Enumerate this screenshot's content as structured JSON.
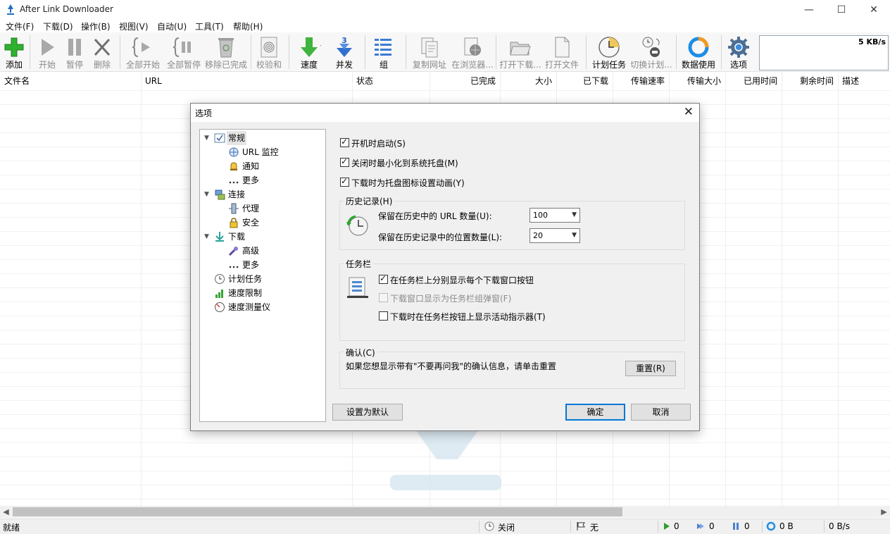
{
  "window": {
    "title": "After Link Downloader",
    "controls": [
      "—",
      "☐",
      "✕"
    ]
  },
  "menu": [
    "文件(F)",
    "下载(D)",
    "操作(B)",
    "视图(V)",
    "自动(U)",
    "工具(T)",
    "帮助(H)"
  ],
  "toolbar": {
    "buttons": [
      {
        "label": "添加",
        "icon": "add-plus-icon",
        "enabled": true
      },
      {
        "label": "开始",
        "icon": "play-icon",
        "enabled": false
      },
      {
        "label": "暂停",
        "icon": "pause-icon",
        "enabled": false
      },
      {
        "label": "删除",
        "icon": "delete-x-icon",
        "enabled": false
      },
      {
        "label": "全部开始",
        "icon": "start-all-icon",
        "enabled": false
      },
      {
        "label": "全部暂停",
        "icon": "pause-all-icon",
        "enabled": false
      },
      {
        "label": "移除已完成",
        "icon": "remove-completed-icon",
        "enabled": false
      },
      {
        "label": "校验和",
        "icon": "checksum-fingerprint-icon",
        "enabled": false
      },
      {
        "label": "速度",
        "icon": "speed-arrow-icon",
        "enabled": true
      },
      {
        "label": "并发",
        "icon": "concurrent-icon",
        "enabled": true
      },
      {
        "label": "组",
        "icon": "group-list-icon",
        "enabled": true
      },
      {
        "label": "复制网址",
        "icon": "copy-url-icon",
        "enabled": false
      },
      {
        "label": "在浏览器...",
        "icon": "open-in-browser-icon",
        "enabled": false
      },
      {
        "label": "打开下载...",
        "icon": "open-folder-icon",
        "enabled": false
      },
      {
        "label": "打开文件",
        "icon": "open-file-icon",
        "enabled": false
      },
      {
        "label": "计划任务",
        "icon": "scheduler-clock-icon",
        "enabled": true
      },
      {
        "label": "切换计划...",
        "icon": "switch-schedule-icon",
        "enabled": false
      },
      {
        "label": "数据使用",
        "icon": "data-usage-ring-icon",
        "enabled": true
      },
      {
        "label": "选项",
        "icon": "options-gear-icon",
        "enabled": true
      }
    ],
    "speed_graph_value": "5 KB/s",
    "concurrent_badge": "3"
  },
  "grid": {
    "columns": [
      "文件名",
      "URL",
      "状态",
      "已完成",
      "大小",
      "已下载",
      "传输速率",
      "传输大小",
      "已用时间",
      "剩余时间",
      "描述"
    ]
  },
  "statusbar": {
    "status": "就绪",
    "scheduler": "关闭",
    "limit": "无",
    "running": "0",
    "queued": "0",
    "paused": "0",
    "downloaded": "0 B",
    "rate": "0 B/s"
  },
  "dialog": {
    "title": "选项",
    "tree": [
      {
        "label": "常规",
        "icon": "general-check-icon",
        "expanded": true,
        "selected": true
      },
      {
        "label": "URL 监控",
        "icon": "url-monitor-icon"
      },
      {
        "label": "通知",
        "icon": "bell-icon"
      },
      {
        "label": "更多",
        "icon": "more-dots-icon"
      },
      {
        "label": "连接",
        "icon": "network-icon",
        "expanded": true
      },
      {
        "label": "代理",
        "icon": "proxy-icon"
      },
      {
        "label": "安全",
        "icon": "lock-icon"
      },
      {
        "label": "下载",
        "icon": "download-arrow-icon",
        "expanded": true
      },
      {
        "label": "高级",
        "icon": "advanced-wrench-icon"
      },
      {
        "label": "更多",
        "icon": "more-dots-icon"
      },
      {
        "label": "计划任务",
        "icon": "clock-icon"
      },
      {
        "label": "速度限制",
        "icon": "speed-bars-icon"
      },
      {
        "label": "速度测量仪",
        "icon": "speedometer-icon"
      }
    ],
    "general": {
      "start_on_boot": {
        "label": "开机时启动(S)",
        "checked": true
      },
      "minimize_to_tray": {
        "label": "关闭时最小化到系统托盘(M)",
        "checked": true
      },
      "animate_tray": {
        "label": "下载时为托盘图标设置动画(Y)",
        "checked": true
      }
    },
    "history": {
      "group_label": "历史记录(H)",
      "url_count_label": "保留在历史中的 URL 数量(U):",
      "url_count_value": "100",
      "location_count_label": "保留在历史记录中的位置数量(L):",
      "location_count_value": "20"
    },
    "taskbar": {
      "group_label": "任务栏",
      "separate_buttons": {
        "label": "在任务栏上分别显示每个下载窗口按钮",
        "checked": true,
        "enabled": true
      },
      "group_popup": {
        "label": "下载窗口显示为任务栏组弹窗(F)",
        "checked": false,
        "enabled": false
      },
      "activity_indicator": {
        "label": "下载时在任务栏按钮上显示活动指示器(T)",
        "checked": false,
        "enabled": true
      }
    },
    "confirm": {
      "group_label": "确认(C)",
      "text": "如果您想显示带有\"不要再问我\"的确认信息，请单击重置",
      "reset_button": "重置(R)"
    },
    "buttons": {
      "default": "设置为默认",
      "ok": "确定",
      "cancel": "取消"
    }
  }
}
